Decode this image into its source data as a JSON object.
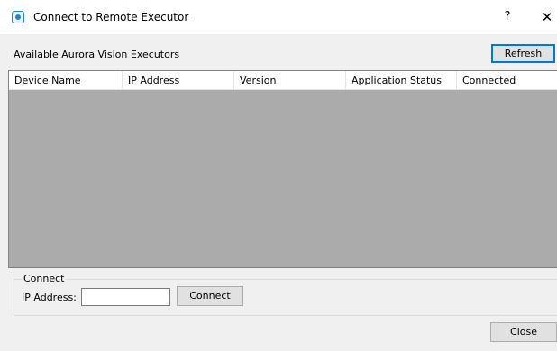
{
  "window": {
    "title": "Connect to Remote Executor",
    "help_label": "?",
    "close_label": "✕"
  },
  "executors": {
    "label": "Available Aurora Vision Executors",
    "refresh_label": "Refresh",
    "columns": [
      "Device Name",
      "IP Address",
      "Version",
      "Application Status",
      "Connected"
    ],
    "rows": []
  },
  "connect_group": {
    "legend": "Connect",
    "ip_label": "IP Address:",
    "ip_value": "",
    "connect_label": "Connect"
  },
  "footer": {
    "close_label": "Close"
  },
  "colors": {
    "list_background": "#ababab",
    "focus_accent": "#0078d7"
  }
}
